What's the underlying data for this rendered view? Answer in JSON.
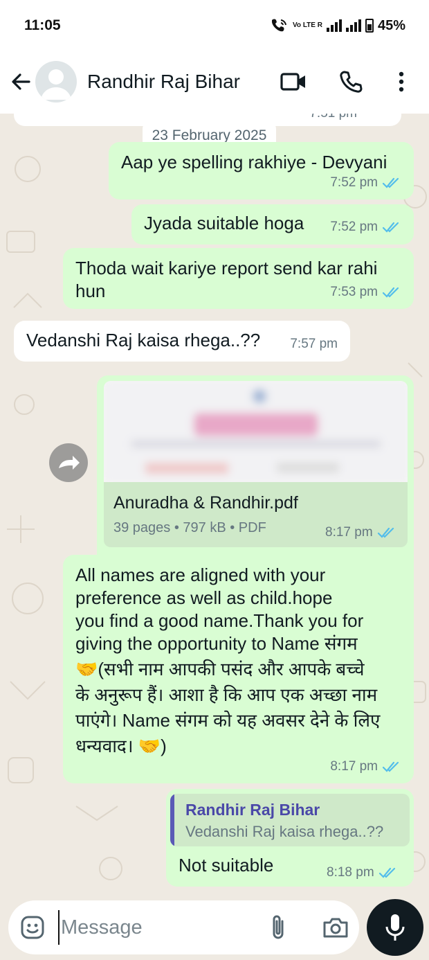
{
  "status": {
    "time": "11:05",
    "network": "Vo LTE R",
    "battery": "45%"
  },
  "header": {
    "contact_name": "Randhir Raj Bihar"
  },
  "chat": {
    "cut_time": "7:51 pm",
    "date_chip": "23 February 2025",
    "messages": [
      {
        "dir": "out",
        "text": "Aap ye spelling rakhiye - Devyani",
        "time": "7:52 pm",
        "status": "read"
      },
      {
        "dir": "out",
        "text": "Jyada suitable hoga",
        "time": "7:52 pm",
        "status": "read"
      },
      {
        "dir": "out",
        "text": "Thoda wait kariye report send kar rahi hun",
        "time": "7:53 pm",
        "status": "read"
      },
      {
        "dir": "in",
        "text": "Vedanshi Raj kaisa rhega..??",
        "time": "7:57 pm"
      },
      {
        "dir": "out",
        "type": "document",
        "file_name": "Anuradha & Randhir.pdf",
        "details": "39 pages • 797 kB • PDF",
        "time": "8:17 pm",
        "status": "read"
      },
      {
        "dir": "out",
        "text_line1": "All names are aligned with your",
        "text_line2": "preference as well as child.hope",
        "text_line3": "you find a good name.Thank you for",
        "text_line4": "giving the opportunity to Name संगम",
        "text_line5": "🤝(सभी नाम आपकी पसंद और आपके बच्चे",
        "text_line6": "के अनुरूप हैं। आशा है कि आप एक अच्छा नाम",
        "text_line7": "पाएंगे। Name संगम को यह अवसर देने के लिए",
        "text_line8": "धन्यवाद। 🤝)",
        "time": "8:17 pm",
        "status": "read"
      },
      {
        "dir": "out",
        "quote_author": "Randhir Raj Bihar",
        "quote_text": "Vedanshi Raj kaisa rhega..??",
        "text": "Not suitable",
        "time": "8:18 pm",
        "status": "read"
      }
    ]
  },
  "input": {
    "placeholder": "Message"
  },
  "colors": {
    "outgoing": "#d9fdd3",
    "incoming": "#ffffff",
    "background": "#efeae2",
    "read_ticks": "#53bdeb",
    "quote_accent": "#5a59b6"
  },
  "icons": [
    "back-arrow-icon",
    "avatar-icon",
    "video-call-icon",
    "voice-call-icon",
    "more-menu-icon",
    "forward-icon",
    "emoji-icon",
    "attach-icon",
    "camera-icon",
    "mic-icon",
    "double-check-icon"
  ]
}
